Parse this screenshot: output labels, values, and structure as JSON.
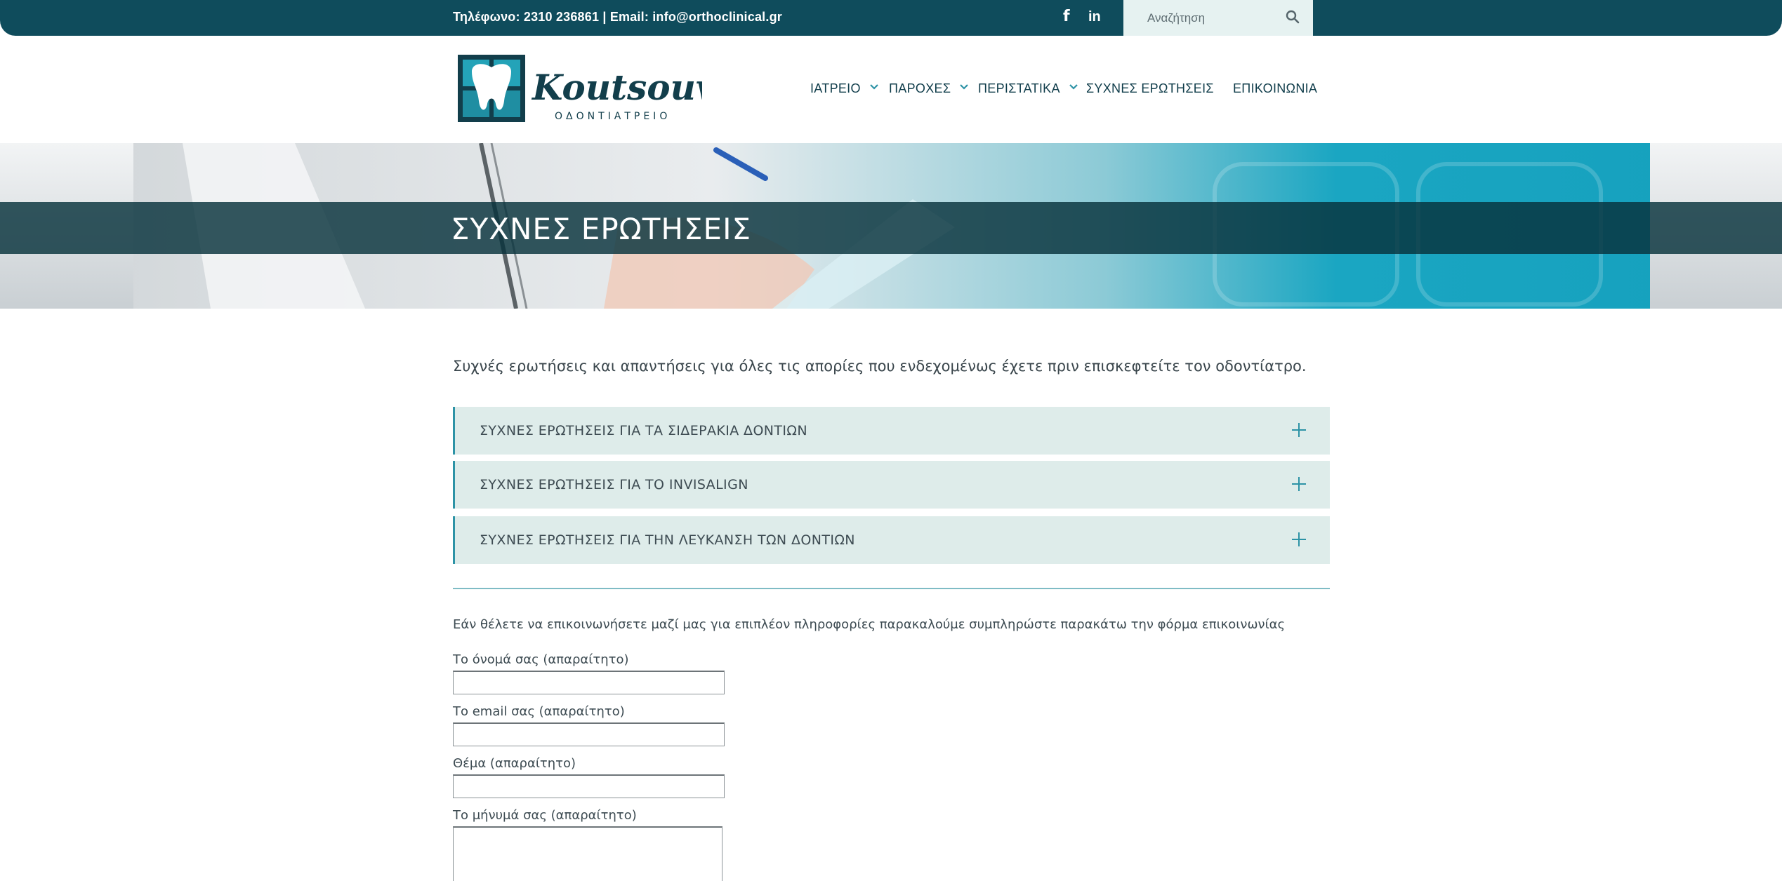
{
  "topbar": {
    "contact": "Τηλέφωνο: 2310 236861 | Email: info@orthoclinical.gr",
    "facebook_glyph": "f",
    "linkedin_glyph": "in",
    "search_placeholder": "Αναζήτηση"
  },
  "brand": {
    "name": "Koutsouvelis",
    "tagline": "ΟΔΟΝΤΙΑΤΡΕΙΟ",
    "colors": {
      "primary": "#0f4c5c",
      "accent": "#2d93a6",
      "logo_teal": "#1f9bb0"
    }
  },
  "nav": {
    "items": [
      {
        "label": "ΙΑΤΡΕΙΟ",
        "has_dropdown": true
      },
      {
        "label": "ΠΑΡΟΧΕΣ",
        "has_dropdown": true
      },
      {
        "label": "ΠΕΡΙΣΤΑΤΙΚΑ",
        "has_dropdown": true
      },
      {
        "label": "ΣΥΧΝΕΣ ΕΡΩΤΗΣΕΙΣ",
        "has_dropdown": false
      },
      {
        "label": "ΕΠΙΚΟΙΝΩΝΙΑ",
        "has_dropdown": false
      }
    ]
  },
  "banner": {
    "title": "ΣΥΧΝΕΣ ΕΡΩΤΗΣΕΙΣ"
  },
  "main": {
    "intro": "Συχνές ερωτήσεις και απαντήσεις για όλες τις απορίες που ενδεχομένως έχετε πριν επισκεφτείτε τον οδοντίατρο.",
    "accordion": [
      {
        "label": "ΣΥΧΝΕΣ ΕΡΩΤΗΣΕΙΣ ΓΙΑ ΤΑ ΣΙΔΕΡΑΚΙΑ ΔΟΝΤΙΩΝ",
        "icon": "plus-icon"
      },
      {
        "label": "ΣΥΧΝΕΣ ΕΡΩΤΗΣΕΙΣ ΓΙΑ ΤΟ INVISALIGN",
        "icon": "plus-icon"
      },
      {
        "label": "ΣΥΧΝΕΣ ΕΡΩΤΗΣΕΙΣ ΓΙΑ ΤΗΝ ΛΕΥΚΑΝΣΗ ΤΩΝ ΔΟΝΤΙΩΝ",
        "icon": "plus-icon"
      }
    ]
  },
  "form": {
    "intro": "Εάν θέλετε να επικοινωνήσετε μαζί μας για επιπλέον πληροφορίες παρακαλούμε συμπληρώστε παρακάτω την φόρμα επικοινωνίας",
    "name_label": "Το όνομά σας (απαραίτητο)",
    "email_label": "Το email σας (απαραίτητο)",
    "subject_label": "Θέμα (απαραίτητο)",
    "message_label": "Το μήνυμά σας (απαραίτητο)",
    "name_value": "",
    "email_value": "",
    "subject_value": "",
    "message_value": ""
  }
}
